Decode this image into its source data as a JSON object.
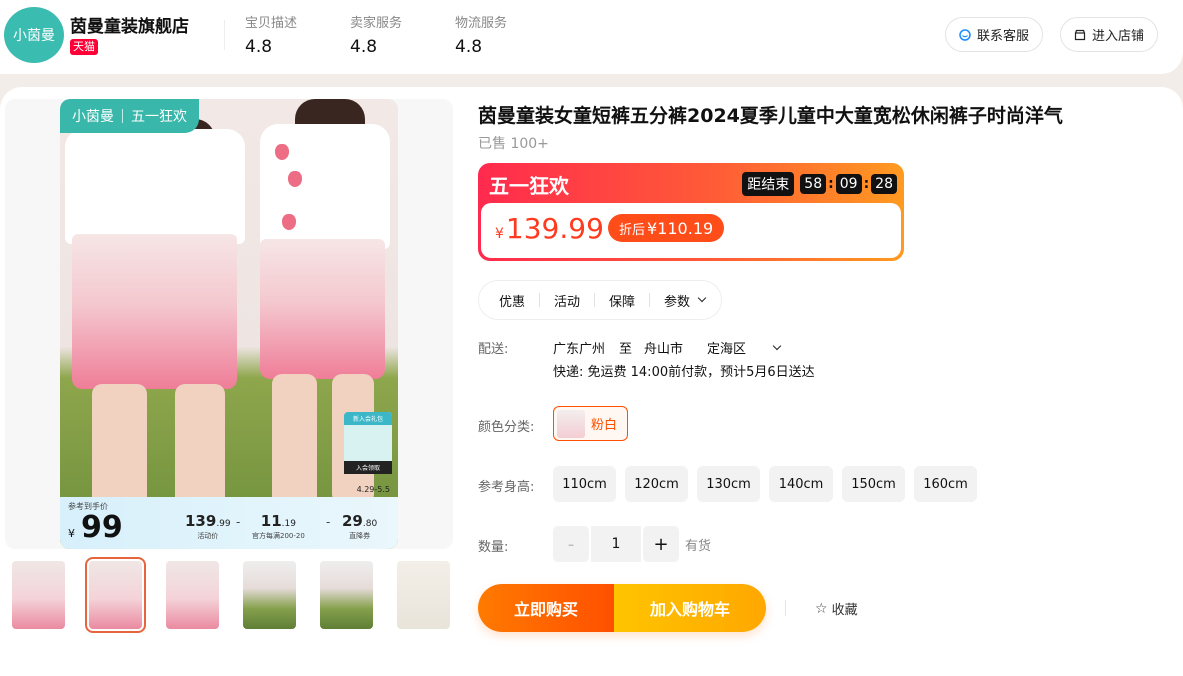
{
  "store": {
    "logo_text": "小茵曼",
    "name": "茵曼童装旗舰店",
    "badge": "天猫",
    "ratings": [
      {
        "label": "宝贝描述",
        "value": "4.8"
      },
      {
        "label": "卖家服务",
        "value": "4.8"
      },
      {
        "label": "物流服务",
        "value": "4.8"
      }
    ],
    "contact_button": "联系客服",
    "enter_shop_button": "进入店铺"
  },
  "gallery": {
    "tag_brand": "小茵曼",
    "tag_event": "五一狂欢",
    "price_bar": {
      "label": "参考到手价",
      "currency": "¥",
      "final_price": "99",
      "seg1_value": "139",
      "seg1_decimal": ".99",
      "seg1_sub": "活动价",
      "minus1": "-",
      "seg2_value": "11",
      "seg2_decimal": ".19",
      "seg2_sub": "官方每满200-20",
      "minus2": "-",
      "seg3_value": "29",
      "seg3_decimal": ".80",
      "seg3_sub": "直降券"
    },
    "promo_card_title": "新入会礼包",
    "promo_card_footer": "入会领取",
    "promo_date": "4.29-5.5",
    "thumbnails": [
      "thumb-1",
      "thumb-2",
      "thumb-3",
      "thumb-4",
      "thumb-5",
      "thumb-6"
    ],
    "active_thumbnail": 2
  },
  "product": {
    "title": "茵曼童装女童短裤五分裤2024夏季儿童中大童宽松休闲裤子时尚洋气",
    "sold": "已售 100+",
    "promo": {
      "title": "五一狂欢",
      "countdown_label": "距结束",
      "hours": "58",
      "minutes": "09",
      "seconds": "28",
      "currency": "¥",
      "price": "139.99",
      "discount_prefix": "折后",
      "discount_price": "¥110.19"
    },
    "tabs": [
      "优惠",
      "活动",
      "保障",
      "参数"
    ],
    "shipping": {
      "label": "配送:",
      "from": "广东广州",
      "to_word": "至",
      "to_city": "舟山市",
      "district": "定海区",
      "detail": "快递: 免运费  14:00前付款，预计5月6日送达"
    },
    "color": {
      "label": "颜色分类:",
      "option": "粉白"
    },
    "size": {
      "label": "参考身高:",
      "options": [
        "110cm",
        "120cm",
        "130cm",
        "140cm",
        "150cm",
        "160cm"
      ]
    },
    "quantity": {
      "label": "数量:",
      "value": "1",
      "minus": "-",
      "plus": "+",
      "stock": "有货"
    },
    "buy_now": "立即购买",
    "add_to_cart": "加入购物车",
    "favorite": "收藏"
  },
  "colors": {
    "accent": "#ff5000",
    "brand_teal": "#3bbcb0",
    "promo_red": "#ff2a4e",
    "tmall_red": "#ff0036"
  }
}
